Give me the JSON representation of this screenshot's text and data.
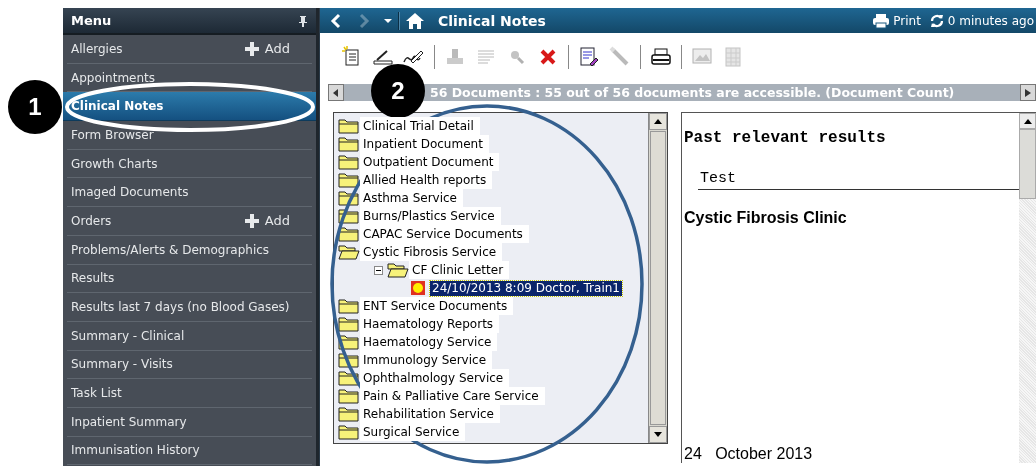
{
  "sidebar": {
    "title": "Menu",
    "items": [
      {
        "label": "Allergies",
        "selected": false,
        "add": "Add"
      },
      {
        "label": "Appointments",
        "selected": false
      },
      {
        "label": "Clinical Notes",
        "selected": true
      },
      {
        "label": "Form Browser",
        "selected": false
      },
      {
        "label": "Growth Charts",
        "selected": false
      },
      {
        "label": "Imaged Documents",
        "selected": false
      },
      {
        "label": "Orders",
        "selected": false,
        "add": "Add"
      },
      {
        "label": "Problems/Alerts & Demographics",
        "selected": false
      },
      {
        "label": "Results",
        "selected": false
      },
      {
        "label": "Results last 7 days (no Blood Gases)",
        "selected": false
      },
      {
        "label": "Summary - Clinical",
        "selected": false
      },
      {
        "label": "Summary - Visits",
        "selected": false
      },
      {
        "label": "Task List",
        "selected": false
      },
      {
        "label": "Inpatient Summary",
        "selected": false
      },
      {
        "label": "Immunisation History",
        "selected": false
      }
    ]
  },
  "header": {
    "title": "Clinical Notes",
    "back": {
      "disabled": false
    },
    "forward": {
      "disabled": true
    },
    "print": "Print",
    "refreshed": "0 minutes ago"
  },
  "toolbar": [
    {
      "kind": "new-note",
      "disabled": false
    },
    {
      "kind": "scanner",
      "disabled": false
    },
    {
      "kind": "signature",
      "disabled": false
    },
    {
      "kind": "separator"
    },
    {
      "kind": "stamp",
      "disabled": true
    },
    {
      "kind": "list",
      "disabled": true
    },
    {
      "kind": "search",
      "disabled": true
    },
    {
      "kind": "delete",
      "disabled": false
    },
    {
      "kind": "separator"
    },
    {
      "kind": "edit-document",
      "disabled": false
    },
    {
      "kind": "wand",
      "disabled": true
    },
    {
      "kind": "separator"
    },
    {
      "kind": "printer",
      "disabled": false
    },
    {
      "kind": "separator"
    },
    {
      "kind": "screen",
      "disabled": true
    },
    {
      "kind": "grid",
      "disabled": true
    }
  ],
  "info_bar": {
    "text": "56 Documents : 55 out of 56 documents are accessible. (Document Count)"
  },
  "tree": {
    "items": [
      {
        "label": "Clinical Trial Detail",
        "kind": "folder",
        "expanded": false,
        "selected": false
      },
      {
        "label": "Inpatient Document",
        "kind": "folder",
        "expanded": false,
        "selected": false
      },
      {
        "label": "Outpatient Document",
        "kind": "folder",
        "expanded": false,
        "selected": false
      },
      {
        "label": "Allied Health reports",
        "kind": "folder",
        "expanded": false,
        "selected": false
      },
      {
        "label": "Asthma Service",
        "kind": "folder",
        "expanded": false,
        "selected": false
      },
      {
        "label": "Burns/Plastics Service",
        "kind": "folder",
        "expanded": false,
        "selected": false
      },
      {
        "label": "CAPAC Service Documents",
        "kind": "folder",
        "expanded": false,
        "selected": false
      },
      {
        "label": "Cystic Fibrosis Service",
        "kind": "folder",
        "expanded": true,
        "selected": false,
        "children": [
          {
            "label": "CF Clinic Letter",
            "kind": "folder",
            "expanded": true,
            "selected": false,
            "children": [
              {
                "label": "24/10/2013 8:09  Doctor, Train1",
                "kind": "document",
                "selected": true
              }
            ]
          }
        ]
      },
      {
        "label": "ENT Service Documents",
        "kind": "folder",
        "expanded": false,
        "selected": false
      },
      {
        "label": "Haematology Reports",
        "kind": "folder",
        "expanded": false,
        "selected": false
      },
      {
        "label": "Haematology Service",
        "kind": "folder",
        "expanded": false,
        "selected": false
      },
      {
        "label": "Immunology Service",
        "kind": "folder",
        "expanded": false,
        "selected": false
      },
      {
        "label": "Ophthalmology Service",
        "kind": "folder",
        "expanded": false,
        "selected": false
      },
      {
        "label": "Pain & Palliative Care Service",
        "kind": "folder",
        "expanded": false,
        "selected": false
      },
      {
        "label": "Rehabilitation Service",
        "kind": "folder",
        "expanded": false,
        "selected": false
      },
      {
        "label": "Surgical Service",
        "kind": "folder",
        "expanded": false,
        "selected": false
      }
    ]
  },
  "document": {
    "heading": "Past relevant results",
    "column_heading": "Test",
    "section": "Cystic Fibrosis Clinic",
    "date": "24   October 2013"
  },
  "callouts": [
    {
      "label": "1"
    },
    {
      "label": "2"
    }
  ]
}
